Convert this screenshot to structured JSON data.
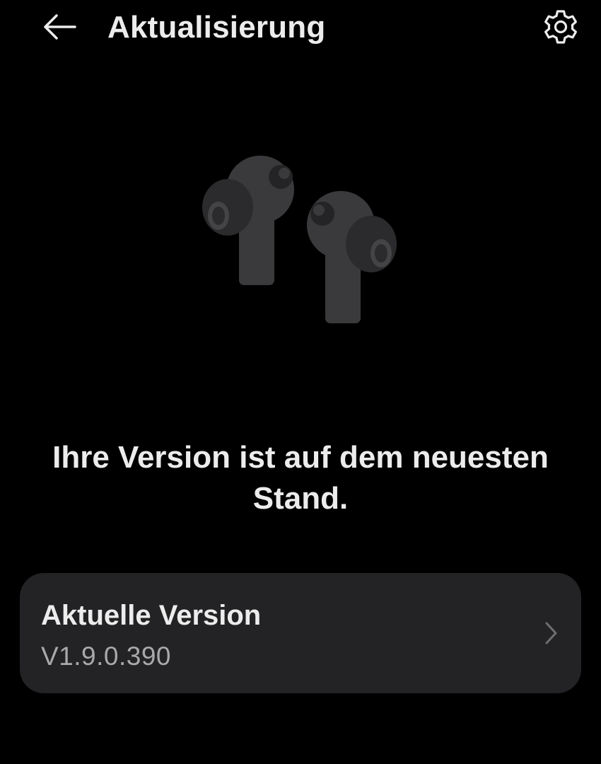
{
  "header": {
    "title": "Aktualisierung",
    "back_icon": "arrow-left-icon",
    "settings_icon": "gear-icon"
  },
  "hero": {
    "image": "earbuds-illustration"
  },
  "status": {
    "message": "Ihre Version ist auf dem neuesten Stand."
  },
  "version_card": {
    "label": "Aktuelle Version",
    "value": "V1.9.0.390",
    "chevron_icon": "chevron-right-icon"
  },
  "colors": {
    "background": "#000000",
    "card": "#232325",
    "text_primary": "#ececec",
    "text_secondary": "#a9a9ab"
  }
}
